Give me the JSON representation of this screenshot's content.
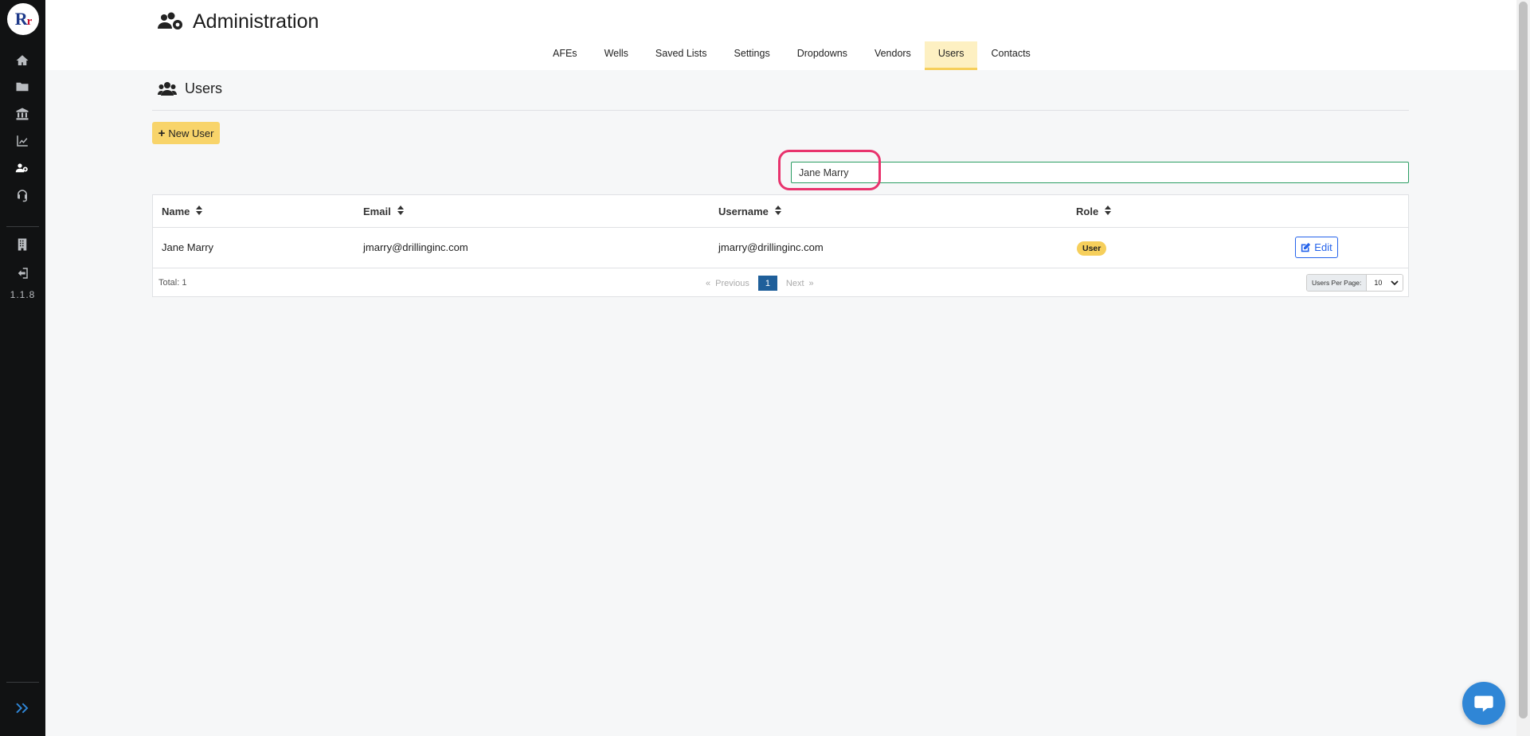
{
  "app": {
    "logo_text_main": "R",
    "logo_text_small": "r",
    "version": "1.1.8"
  },
  "sidebar": {
    "items": [
      {
        "name": "home",
        "icon": "home-icon"
      },
      {
        "name": "folder",
        "icon": "folder-icon"
      },
      {
        "name": "bank",
        "icon": "bank-icon"
      },
      {
        "name": "chart",
        "icon": "chart-line-icon"
      },
      {
        "name": "administration",
        "icon": "users-cog-icon",
        "active": true
      },
      {
        "name": "support",
        "icon": "headset-icon"
      },
      {
        "name": "building",
        "icon": "building-icon"
      },
      {
        "name": "logout",
        "icon": "sign-out-icon"
      }
    ]
  },
  "header": {
    "title": "Administration",
    "tabs": [
      {
        "label": "AFEs"
      },
      {
        "label": "Wells"
      },
      {
        "label": "Saved Lists"
      },
      {
        "label": "Settings"
      },
      {
        "label": "Dropdowns"
      },
      {
        "label": "Vendors"
      },
      {
        "label": "Users",
        "active": true
      },
      {
        "label": "Contacts"
      }
    ]
  },
  "main": {
    "section_title": "Users",
    "new_user_label": "New User",
    "search_value": "Jane Marry",
    "table": {
      "columns": [
        "Name",
        "Email",
        "Username",
        "Role"
      ],
      "rows": [
        {
          "name": "Jane Marry",
          "email": "jmarry@drillinginc.com",
          "username": "jmarry@drillinginc.com",
          "role": "User",
          "action": "Edit"
        }
      ]
    },
    "footer": {
      "total": "Total: 1",
      "first": "«",
      "previous": "Previous",
      "current_page": "1",
      "next": "Next",
      "last": "»",
      "per_page_label": "Users Per Page:",
      "per_page_value": "10"
    }
  },
  "colors": {
    "sidebar_bg": "#111213",
    "accent_yellow": "#f8d46a",
    "active_tab_bg": "#fdf0c2",
    "search_border": "#2a9d62",
    "highlight_ring": "#e8336d",
    "pager_active": "#1f5f9a",
    "edit_blue": "#2563eb",
    "chat_blue": "#2f86d6"
  }
}
